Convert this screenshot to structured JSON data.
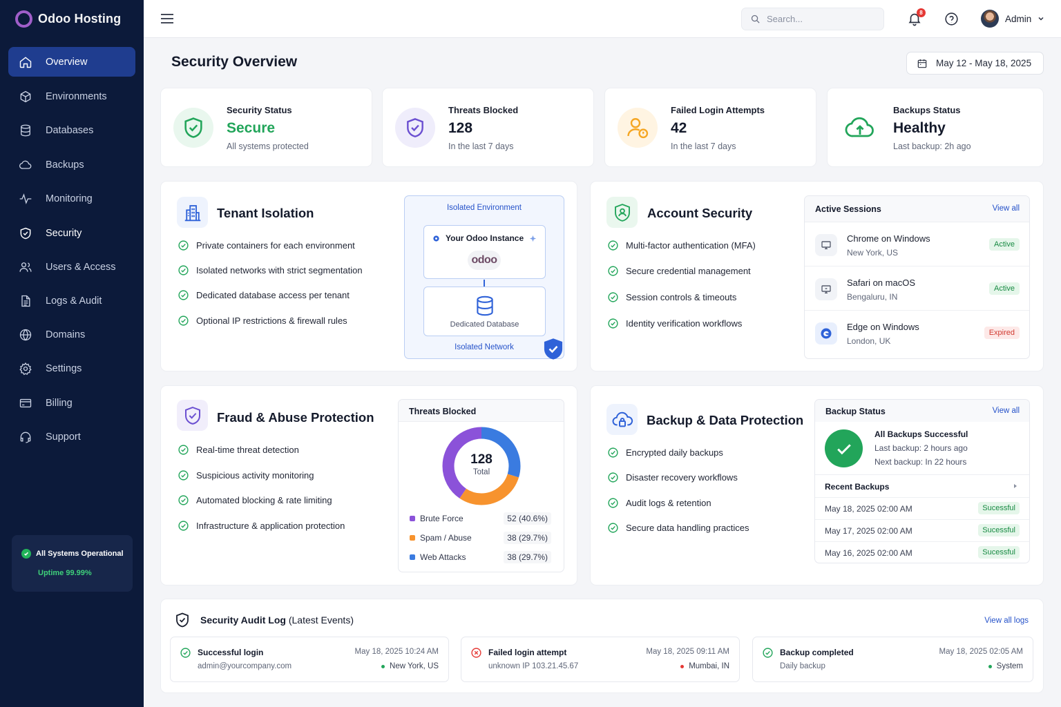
{
  "brand": {
    "name": "Odoo Hosting"
  },
  "sidebar": {
    "items": [
      {
        "label": "Overview",
        "icon": "home-icon",
        "active": true
      },
      {
        "label": "Environments",
        "icon": "cube-icon"
      },
      {
        "label": "Databases",
        "icon": "database-icon"
      },
      {
        "label": "Backups",
        "icon": "cloud-icon"
      },
      {
        "label": "Monitoring",
        "icon": "pulse-icon"
      },
      {
        "label": "Security",
        "icon": "shield-icon"
      },
      {
        "label": "Users & Access",
        "icon": "users-icon"
      },
      {
        "label": "Logs & Audit",
        "icon": "document-icon"
      },
      {
        "label": "Domains",
        "icon": "globe-icon"
      },
      {
        "label": "Settings",
        "icon": "gear-icon"
      },
      {
        "label": "Billing",
        "icon": "credit-card-icon"
      },
      {
        "label": "Support",
        "icon": "headset-icon"
      }
    ],
    "status": {
      "title": "All Systems Operational",
      "uptime": "Uptime 99.99%"
    }
  },
  "topbar": {
    "search_placeholder": "Search...",
    "notification_count": "8",
    "user_name": "Admin"
  },
  "page": {
    "title": "Security Overview",
    "date_range": "May 12 - May 18, 2025"
  },
  "stats": [
    {
      "label": "Security Status",
      "value": "Secure",
      "sub": "All systems protected",
      "color": "#22a55a"
    },
    {
      "label": "Threats Blocked",
      "value": "128",
      "sub": "In the last 7 days",
      "color": "#6b4fd1"
    },
    {
      "label": "Failed Login Attempts",
      "value": "42",
      "sub": "In the last 7 days",
      "color": "#f5a623"
    },
    {
      "label": "Backups Status",
      "value": "Healthy",
      "sub": "Last backup: 2h ago",
      "color": "#22a55a"
    }
  ],
  "tenant": {
    "title": "Tenant Isolation",
    "items": [
      "Private containers for each environment",
      "Isolated networks with strict segmentation",
      "Dedicated database access per tenant",
      "Optional IP restrictions & firewall rules"
    ],
    "diagram": {
      "env_label": "Isolated Environment",
      "instance_label": "Your Odoo Instance",
      "logo_text": "odoo",
      "db_label": "Dedicated Database",
      "network_label": "Isolated Network"
    }
  },
  "account": {
    "title": "Account Security",
    "items": [
      "Multi-factor authentication (MFA)",
      "Secure credential management",
      "Session controls & timeouts",
      "Identity verification workflows"
    ],
    "sessions": {
      "title": "Active Sessions",
      "view_all": "View all",
      "rows": [
        {
          "name": "Chrome on Windows",
          "location": "New York, US",
          "status": "Active"
        },
        {
          "name": "Safari on macOS",
          "location": "Bengaluru, IN",
          "status": "Active"
        },
        {
          "name": "Edge on Windows",
          "location": "London, UK",
          "status": "Expired"
        }
      ]
    }
  },
  "fraud": {
    "title": "Fraud & Abuse Protection",
    "items": [
      "Real-time threat detection",
      "Suspicious activity monitoring",
      "Automated blocking & rate limiting",
      "Infrastructure & application protection"
    ],
    "panel_title": "Threats Blocked",
    "total": "128",
    "total_label": "Total"
  },
  "chart_data": {
    "type": "pie",
    "title": "Threats Blocked",
    "center_value": "128",
    "center_label": "Total",
    "slices": [
      {
        "name": "Brute Force",
        "value": 52,
        "label": "52 (40.6%)",
        "color": "#8b52d9"
      },
      {
        "name": "Spam / Abuse",
        "value": 38,
        "label": "38 (29.7%)",
        "color": "#f7932e"
      },
      {
        "name": "Web Attacks",
        "value": 38,
        "label": "38 (29.7%)",
        "color": "#3a7be0"
      }
    ]
  },
  "backup": {
    "title": "Backup & Data Protection",
    "items": [
      "Encrypted daily backups",
      "Disaster recovery workflows",
      "Audit logs & retention",
      "Secure data handling practices"
    ],
    "panel": {
      "title": "Backup Status",
      "view_all": "View all",
      "status_title": "All Backups Successful",
      "last": "Last backup: 2 hours ago",
      "next": "Next backup: In 22 hours",
      "recent_title": "Recent Backups",
      "rows": [
        {
          "date": "May 18, 2025 02:00 AM",
          "status": "Sucessful"
        },
        {
          "date": "May 17, 2025 02:00 AM",
          "status": "Sucessful"
        },
        {
          "date": "May 16, 2025 02:00 AM",
          "status": "Sucessful"
        }
      ]
    }
  },
  "audit": {
    "title": "Security Audit Log",
    "subtitle": "(Latest Events)",
    "view_all": "View all logs",
    "events": [
      {
        "title": "Successful login",
        "detail": "admin@yourcompany.com",
        "time": "May 18, 2025 10:24 AM",
        "location": "New York, US",
        "color": "#22a55a"
      },
      {
        "title": "Failed login attempt",
        "detail": "unknown IP 103.21.45.67",
        "time": "May 18, 2025 09:11 AM",
        "location": "Mumbai, IN",
        "color": "#e53935"
      },
      {
        "title": "Backup completed",
        "detail": "Daily backup",
        "time": "May 18, 2025 02:05 AM",
        "location": "System",
        "color": "#22a55a"
      }
    ]
  }
}
